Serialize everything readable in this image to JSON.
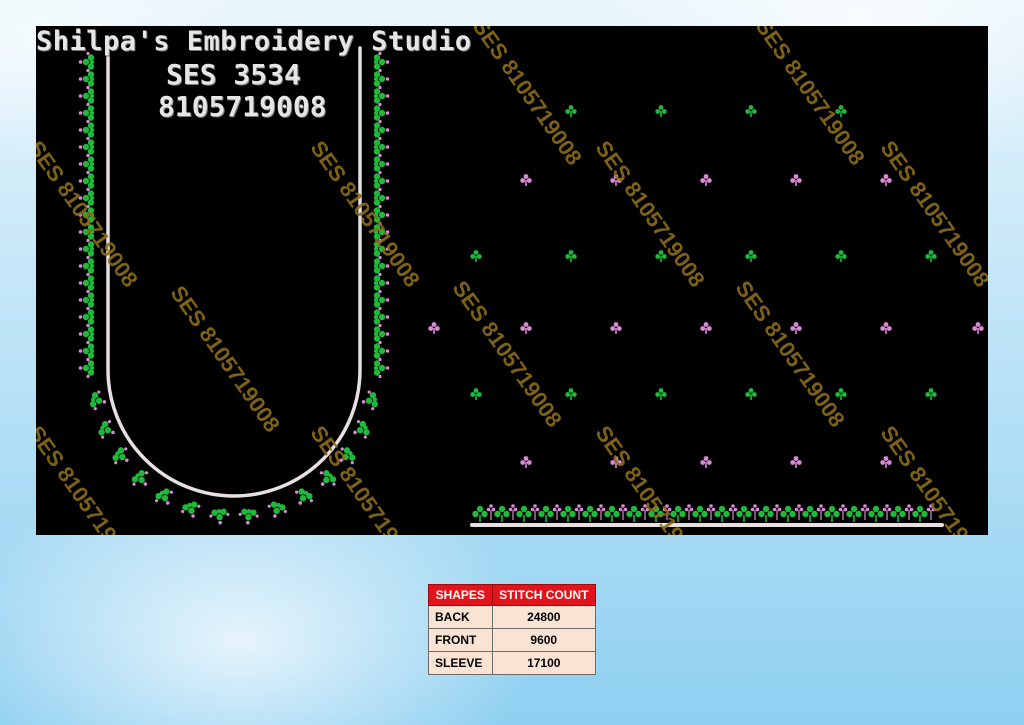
{
  "brand": {
    "name": "Shilpa's Embroidery Studio",
    "code": "SES 3534",
    "phone": "8105719008"
  },
  "watermark": "SES 8105719008",
  "colors": {
    "background_top": "#e9f5fc",
    "background_bottom": "#8fd0f1",
    "canvas": "#000000",
    "border_line": "#e8e0e0",
    "motif_green": "#1fb83a",
    "motif_pink": "#d98ad6",
    "watermark": "#8a6c1a",
    "table_header": "#e1131b",
    "table_cell": "#fbe3d4"
  },
  "stitch_table": {
    "headers": [
      "SHAPES",
      "STITCH COUNT"
    ],
    "rows": [
      {
        "shape": "BACK",
        "count": "24800"
      },
      {
        "shape": "FRONT",
        "count": "9600"
      },
      {
        "shape": "SLEEVE",
        "count": "17100"
      }
    ]
  }
}
